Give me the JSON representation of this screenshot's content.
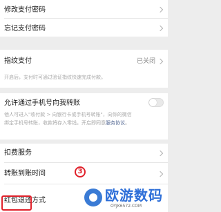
{
  "settings": {
    "change_password": "修改支付密码",
    "forgot_password": "忘记支付密码",
    "fingerprint": {
      "label": "指纹支付",
      "value": "已关闭",
      "desc": "开启后，支付时可通过验证指纹快速完成付款。"
    },
    "phone_transfer": {
      "label": "允许通过手机号向我转账",
      "desc_line1": "他人可进入\"收付款 > 向银行卡或手机号转账\"，向你的微信",
      "desc_line2_text": "绑定手机号转账，收款将存入零钱。开启即同意",
      "desc_link": "服务协议",
      "desc_end": "。"
    },
    "deduction": "扣费服务",
    "transfer_time": "转账到账时间",
    "red_packet": "红包退还方式"
  },
  "markers": {
    "step_number": "3"
  },
  "watermark": {
    "brand": "欧游数码",
    "url": "OYJK6572.COM"
  },
  "colors": {
    "background": "#ededed",
    "link": "#576b95",
    "highlight": "#e0202a",
    "watermark": "#2e6fd8"
  }
}
